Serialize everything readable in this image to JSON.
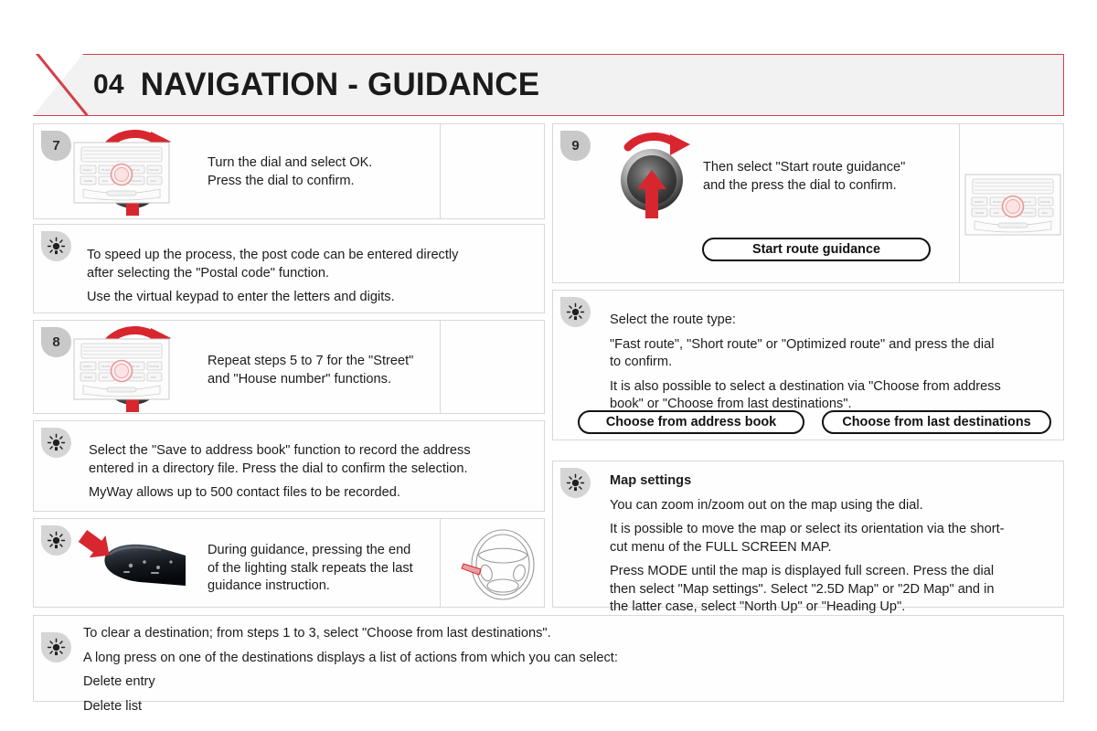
{
  "header": {
    "chapter_number": "04",
    "title": "NAVIGATION - GUIDANCE",
    "accent_color": "#d4404a"
  },
  "left_column": {
    "step7": {
      "badge": "7",
      "line1": "Turn the dial and select OK.",
      "line2": "Press the dial to confirm.",
      "dial_icon": "rotate-and-press-dial-icon",
      "device_icon": "car-radio-unit-icon"
    },
    "tip1": {
      "icon": "tip-light-icon",
      "line1": "To speed up the process, the post code can be entered directly",
      "line2": "after selecting the \"Postal code\" function.",
      "line3": "Use the virtual keypad to enter the letters and digits."
    },
    "step8": {
      "badge": "8",
      "line1": "Repeat steps 5 to 7 for the \"Street\"",
      "line2": "and \"House number\" functions.",
      "dial_icon": "rotate-and-press-dial-icon",
      "device_icon": "car-radio-unit-icon"
    },
    "tip2": {
      "icon": "tip-light-icon",
      "line1": "Select the \"Save to address book\" function to record the address",
      "line2": "entered in a directory file. Press the dial to confirm the selection.",
      "line3": "MyWay allows up to 500 contact files to be recorded."
    },
    "tip3": {
      "icon": "tip-light-icon",
      "line1": "During guidance, pressing the end",
      "line2": "of the lighting stalk repeats the last",
      "line3": "guidance instruction.",
      "stalk_icon": "lighting-stalk-icon",
      "device_icon": "steering-wheel-icon"
    }
  },
  "right_column": {
    "step9": {
      "badge": "9",
      "line1": "Then select \"Start route guidance\"",
      "line2": "and the press the dial to confirm.",
      "button_label": "Start route guidance",
      "dial_icon": "rotate-and-press-dial-icon",
      "device_icon": "car-radio-unit-icon"
    },
    "tip4": {
      "icon": "tip-light-icon",
      "line1": "Select the route type:",
      "line2": "\"Fast route\", \"Short route\" or \"Optimized route\" and press the dial",
      "line3": "to confirm.",
      "line4": "It is also possible to select a destination via \"Choose from address",
      "line5": "book\" or \"Choose from last destinations\".",
      "button_address_book": "Choose from address book",
      "button_last_destinations": "Choose from last destinations"
    },
    "tip5": {
      "icon": "tip-light-icon",
      "heading": "Map settings",
      "line1": "You can zoom in/zoom out on the map using the dial.",
      "line2": "It is possible to move the map or select its orientation via the short-",
      "line3": "cut menu of the FULL SCREEN MAP.",
      "line4": "Press MODE until the map is displayed full screen. Press the dial",
      "line5": "then select \"Map settings\". Select \"2.5D Map\" or \"2D Map\" and in",
      "line6": "the latter case, select \"North Up\" or \"Heading Up\"."
    }
  },
  "bottom_note": {
    "icon": "tip-light-icon",
    "line1": "To clear a destination; from steps 1 to 3, select \"Choose from last destinations\".",
    "line2": "A long press on one of the destinations displays a list of actions from which you can select:",
    "line3": "Delete entry",
    "line4": "Delete list"
  }
}
